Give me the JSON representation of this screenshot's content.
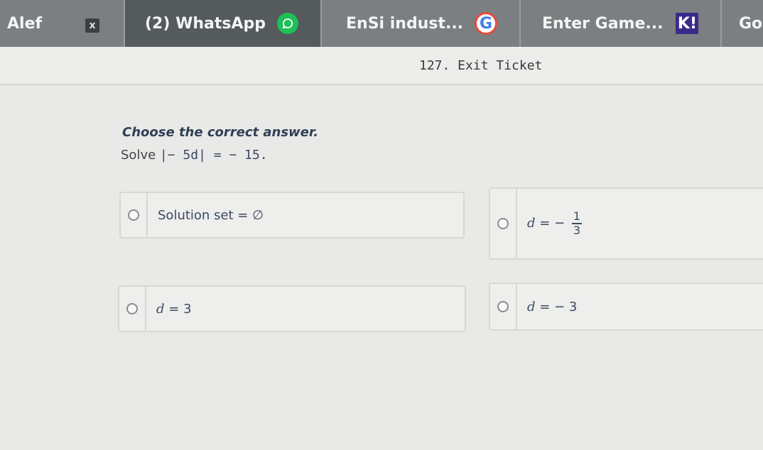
{
  "tabs": [
    {
      "label": "Alef",
      "icon": "close-icon",
      "close_glyph": "x"
    },
    {
      "label": "(2) WhatsApp",
      "icon": "whatsapp-icon"
    },
    {
      "label": "EnSi indust...",
      "icon": "google-icon",
      "icon_text": "G"
    },
    {
      "label": "Enter Game...",
      "icon": "kahoot-icon",
      "icon_text": "K!"
    },
    {
      "label": "Go"
    }
  ],
  "header": {
    "title": "127. Exit Ticket"
  },
  "question": {
    "prompt": "Choose the correct answer.",
    "solve_word": "Solve",
    "equation": "|− 5d| = − 15."
  },
  "options": [
    {
      "label": "Solution set = ∅"
    },
    {
      "lhs": "d",
      "rel": "= −",
      "num": "1",
      "den": "3"
    },
    {
      "lhs": "d",
      "rel": "= 3"
    },
    {
      "lhs": "d",
      "rel": "= − 3"
    }
  ],
  "colors": {
    "tabbar": "#7b7f81",
    "whatsapp": "#1fbf57",
    "kahoot": "#3b2a8c",
    "prompt_text": "#2f3f55"
  }
}
